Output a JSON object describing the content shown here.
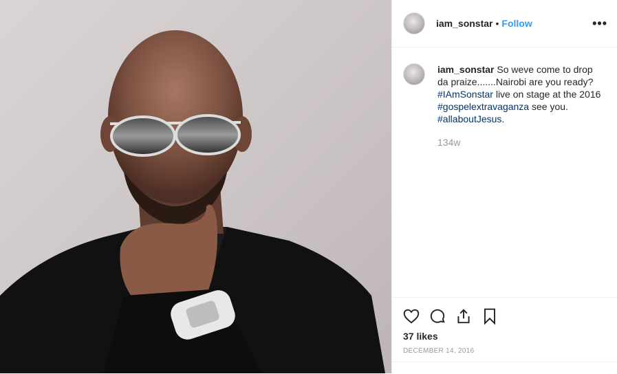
{
  "post": {
    "username": "iam_sonstar",
    "separator": "•",
    "follow_label": "Follow",
    "more_label": "•••"
  },
  "caption": {
    "username": "iam_sonstar",
    "text_part1": " So weve come to drop da praize.......Nairobi are you ready? ",
    "hashtag1": "#IAmSonstar",
    "text_part2": " live on stage at the 2016 ",
    "hashtag2": "#gospelextravaganza",
    "text_part3": " see you. ",
    "hashtag3": "#allaboutJesus",
    "text_part4": ".",
    "time_ago": "134w"
  },
  "actions": {
    "like_icon": "heart-icon",
    "comment_icon": "comment-icon",
    "share_icon": "share-icon",
    "save_icon": "bookmark-icon",
    "likes": "37 likes",
    "date": "DECEMBER 14, 2016"
  },
  "colors": {
    "accent": "#3897f0",
    "hashtag": "#003569",
    "muted": "#999999"
  }
}
